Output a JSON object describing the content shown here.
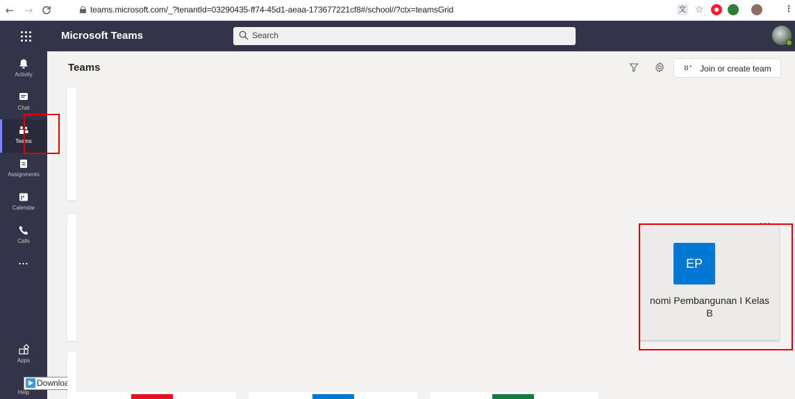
{
  "browser": {
    "url": "teams.microsoft.com/_?tenantId=03290435-ff74-45d1-aeaa-173677221cf8#/school//?ctx=teamsGrid",
    "icons": [
      "back-arrow-icon",
      "forward-arrow-icon",
      "reload-icon",
      "lock-icon",
      "translate-icon",
      "star-icon",
      "opera-icon",
      "extension-icon",
      "profile-icon",
      "menu-icon"
    ]
  },
  "header": {
    "app_title": "Microsoft Teams",
    "search_placeholder": "Search"
  },
  "rail": {
    "items": [
      {
        "label": "Activity",
        "icon": "bell-icon"
      },
      {
        "label": "Chat",
        "icon": "chat-icon"
      },
      {
        "label": "Teams",
        "icon": "teams-icon",
        "active": true
      },
      {
        "label": "Assignments",
        "icon": "assignments-icon"
      },
      {
        "label": "Calendar",
        "icon": "calendar-icon"
      },
      {
        "label": "Calls",
        "icon": "phone-icon"
      },
      {
        "label": "...",
        "icon": "more-icon"
      }
    ],
    "apps_label": "Apps",
    "help_label": "Help",
    "download_label": "Download"
  },
  "main": {
    "title": "Teams",
    "join_label": "Join or create team",
    "team_card": {
      "initials": "EP",
      "name_line1": "nomi Pembangunan I Kelas",
      "name_line2": "B",
      "more": "···"
    },
    "bottom_tile_colors": [
      "#e81123",
      "#0078d4",
      "#107c41"
    ]
  },
  "annotation_color": "#e00000",
  "accent_color": "#33344a"
}
